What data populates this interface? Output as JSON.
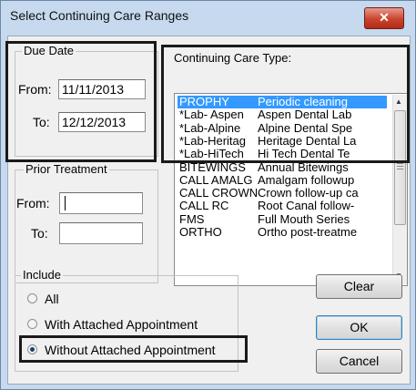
{
  "window": {
    "title": "Select Continuing Care Ranges",
    "close_glyph": "✕"
  },
  "due_date": {
    "legend": "Due Date",
    "from_label": "From:",
    "from_value": "11/11/2013",
    "to_label": "To:",
    "to_value": "12/12/2013"
  },
  "prior_treatment": {
    "legend": "Prior Treatment",
    "from_label": "From:",
    "from_value": "",
    "to_label": "To:",
    "to_value": ""
  },
  "care_types": {
    "label": "Continuing Care Type:",
    "items": [
      {
        "code": "PROPHY",
        "desc": "Periodic cleaning",
        "selected": true
      },
      {
        "code": "*Lab- Aspen",
        "desc": "Aspen Dental Lab"
      },
      {
        "code": "*Lab-Alpine",
        "desc": "Alpine Dental Spe"
      },
      {
        "code": "*Lab-Heritag",
        "desc": "Heritage Dental La"
      },
      {
        "code": "*Lab-HiTech",
        "desc": "Hi Tech Dental Te"
      },
      {
        "code": "BITEWINGS",
        "desc": "Annual Bitewings"
      },
      {
        "code": "CALL AMALG",
        "desc": "Amalgam followup"
      },
      {
        "code": "CALL CROWN",
        "desc": "Crown follow-up ca"
      },
      {
        "code": "CALL RC",
        "desc": "Root Canal follow-"
      },
      {
        "code": "FMS",
        "desc": "Full Mouth Series"
      },
      {
        "code": "ORTHO",
        "desc": "Ortho post-treatme"
      }
    ]
  },
  "include": {
    "legend": "Include",
    "options": [
      {
        "label": "All",
        "checked": false
      },
      {
        "label": "With Attached Appointment",
        "checked": false
      },
      {
        "label": "Without Attached Appointment",
        "checked": true
      }
    ]
  },
  "buttons": {
    "clear": "Clear",
    "ok": "OK",
    "cancel": "Cancel"
  }
}
